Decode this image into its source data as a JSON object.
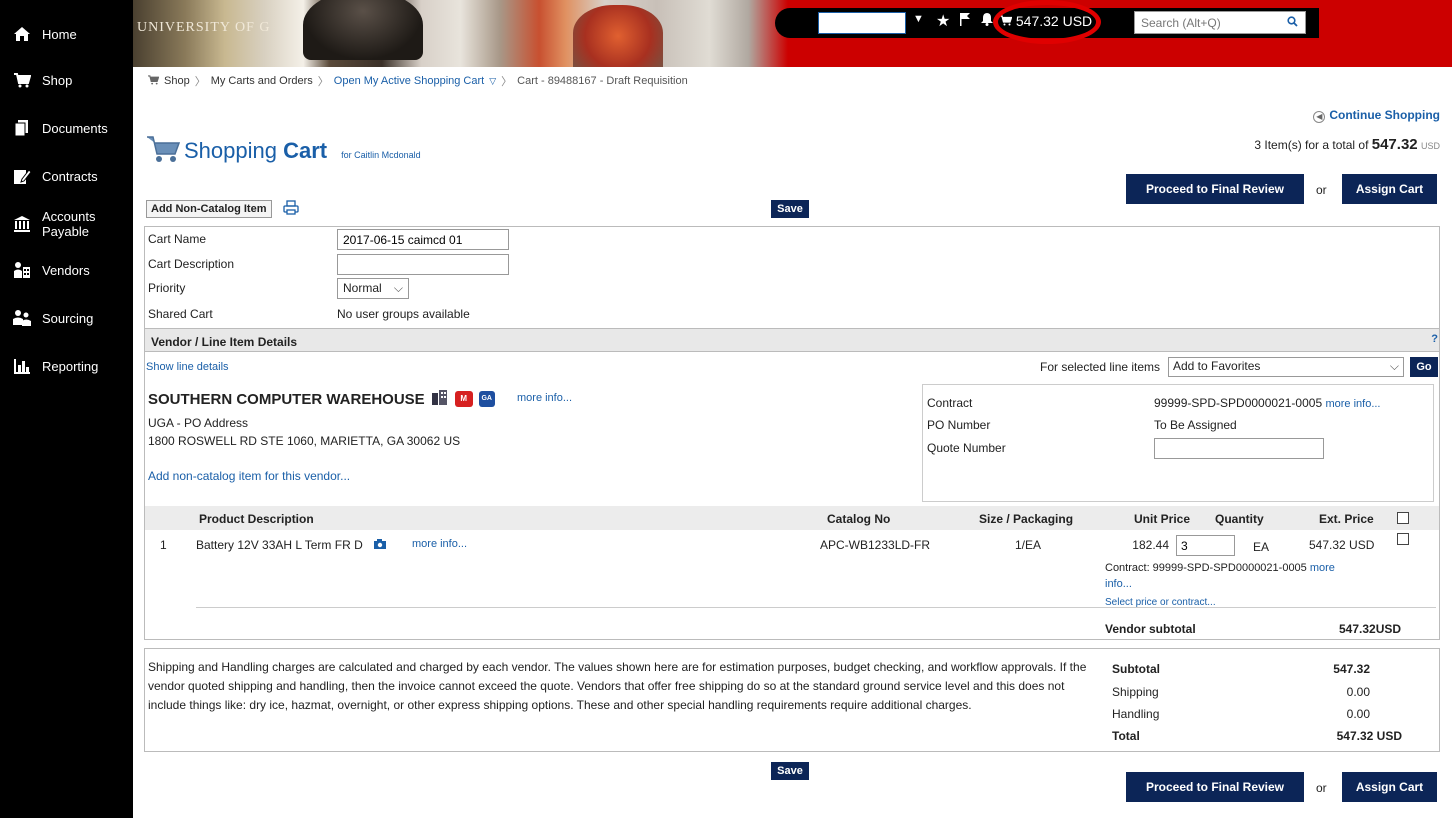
{
  "sidebar": {
    "items": [
      {
        "label": "Home",
        "icon": "home-icon"
      },
      {
        "label": "Shop",
        "icon": "cart-icon"
      },
      {
        "label": "Documents",
        "icon": "documents-icon"
      },
      {
        "label": "Contracts",
        "icon": "contracts-icon"
      },
      {
        "label": "Accounts",
        "label2": "Payable",
        "icon": "bank-icon"
      },
      {
        "label": "Vendors",
        "icon": "vendors-icon"
      },
      {
        "label": "Sourcing",
        "icon": "sourcing-icon"
      },
      {
        "label": "Reporting",
        "icon": "reporting-icon"
      }
    ]
  },
  "header": {
    "banner_logo": "UNIVERSITY OF G",
    "cart_total": "547.32 USD",
    "search_placeholder": "Search (Alt+Q)"
  },
  "breadcrumb": {
    "shop": "Shop",
    "carts": "My Carts and Orders",
    "active_cart": "Open My Active Shopping Cart",
    "current": "Cart - 89488167 - Draft Requisition"
  },
  "page": {
    "continue": "Continue Shopping",
    "items_summary": "3 Item(s)  for a total of ",
    "items_total": "547.32",
    "items_currency": "USD",
    "title_light": "Shopping ",
    "title_bold": "Cart",
    "title_for": "for Caitlin Mcdonald",
    "proceed": "Proceed to Final Review",
    "or": "or",
    "assign": "Assign Cart",
    "add_non_catalog": "Add Non-Catalog Item",
    "save": "Save"
  },
  "cart_form": {
    "name_label": "Cart Name",
    "name_value": "2017-06-15 caimcd 01",
    "desc_label": "Cart Description",
    "desc_value": "",
    "priority_label": "Priority",
    "priority_value": "Normal",
    "shared_label": "Shared Cart",
    "shared_value": "No user groups available"
  },
  "vendor_section": {
    "bar_title": "Vendor / Line Item Details",
    "help": "?",
    "show_line_details": "Show line details",
    "for_selected": "For selected line items",
    "action_value": "Add to Favorites",
    "go": "Go",
    "vendor_name": "SOUTHERN COMPUTER WAREHOUSE",
    "badge_m": "M",
    "badge_ga": "GA",
    "more_info": "more info...",
    "address1": "UGA - PO Address",
    "address2": "1800 ROSWELL RD STE 1060, MARIETTA, GA 30062 US",
    "add_non_catalog_vendor": "Add non-catalog item for this vendor...",
    "contract_label": "Contract",
    "contract_value": "99999-SPD-SPD0000021-0005",
    "po_label": "PO Number",
    "po_value": "To Be Assigned",
    "quote_label": "Quote Number"
  },
  "table": {
    "headers": {
      "product": "Product Description",
      "catalog": "Catalog No",
      "size": "Size / Packaging",
      "unit_price": "Unit Price",
      "quantity": "Quantity",
      "ext_price": "Ext. Price"
    },
    "rows": [
      {
        "num": "1",
        "product": "Battery 12V 33AH L Term FR D",
        "more": "more info...",
        "catalog": "APC-WB1233LD-FR",
        "size": "1/EA",
        "unit_price": "182.44",
        "quantity": "3",
        "uom": "EA",
        "ext_price": "547.32 USD",
        "contract_line": "Contract: 99999-SPD-SPD0000021-0005",
        "contract_more_a": "more",
        "contract_more_b": "info...",
        "select_price": "Select price or contract..."
      }
    ],
    "vendor_subtotal_label": "Vendor subtotal",
    "vendor_subtotal_value": "547.32USD"
  },
  "totals": {
    "disclaimer": "Shipping and Handling charges are calculated and charged by each vendor. The values shown here are for estimation purposes, budget checking, and workflow approvals. If the vendor quoted shipping and handling, then the invoice cannot exceed the quote. Vendors that offer free shipping do so at the standard ground service level and this does not include things like: dry ice, hazmat, overnight, or other express shipping options. These and other special handling requirements require additional charges.",
    "subtotal_label": "Subtotal",
    "subtotal_value": "547.32",
    "shipping_label": "Shipping",
    "shipping_value": "0.00",
    "handling_label": "Handling",
    "handling_value": "0.00",
    "total_label": "Total",
    "total_value": "547.32 USD"
  },
  "colors": {
    "header_red": "#cc0000",
    "navy": "#0c2557",
    "link": "#1a5fa8",
    "highlight_circle": "#e00000"
  }
}
